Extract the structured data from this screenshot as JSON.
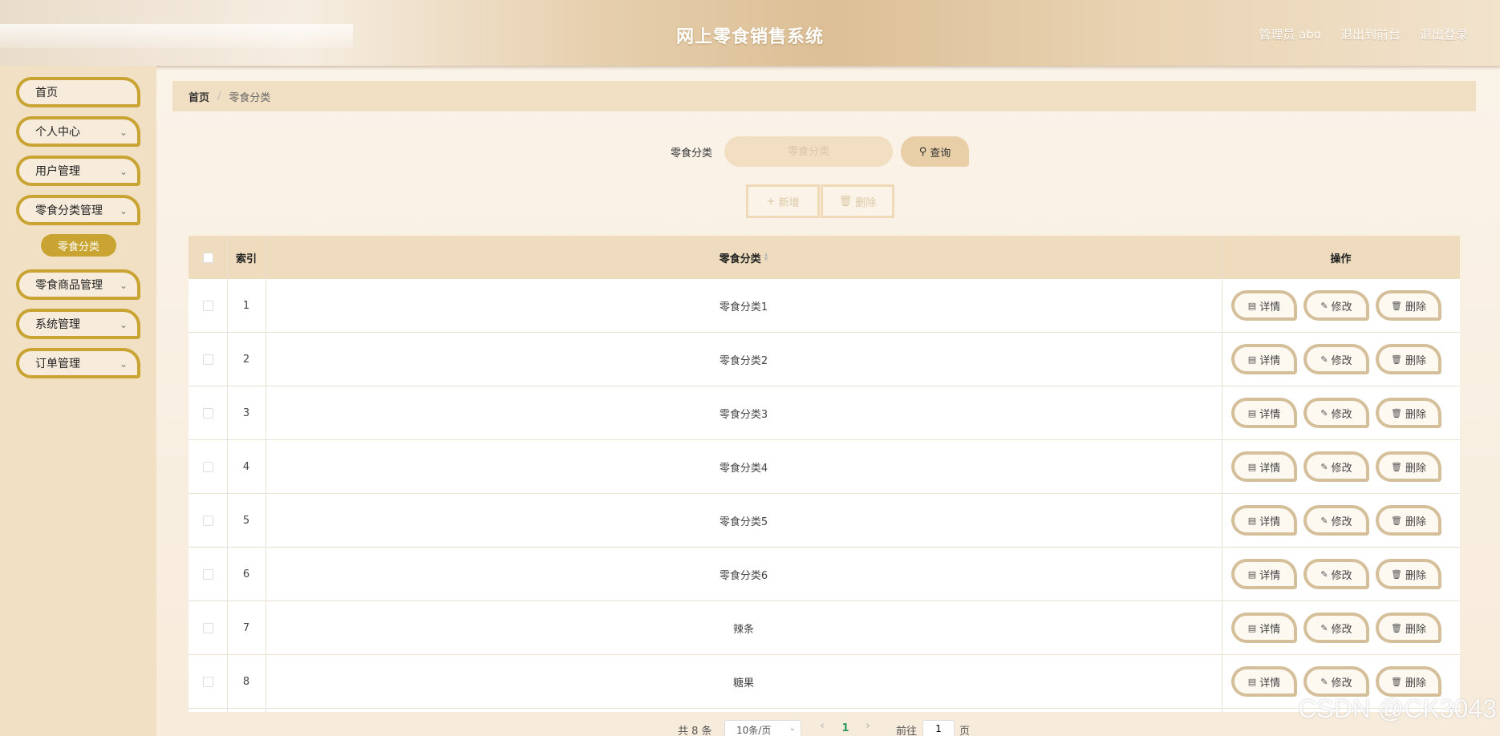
{
  "header": {
    "title": "网上零食销售系统",
    "admin_label": "管理员 abo",
    "front_label": "退出到前台",
    "logout_label": "退出登录"
  },
  "sidebar": {
    "items": [
      {
        "label": "首页",
        "has_children": false
      },
      {
        "label": "个人中心",
        "has_children": true
      },
      {
        "label": "用户管理",
        "has_children": true
      },
      {
        "label": "零食分类管理",
        "has_children": true
      },
      {
        "label": "零食商品管理",
        "has_children": true
      },
      {
        "label": "系统管理",
        "has_children": true
      },
      {
        "label": "订单管理",
        "has_children": true
      }
    ],
    "active_sub": "零食分类"
  },
  "breadcrumb": {
    "home": "首页",
    "sep": "/",
    "current": "零食分类"
  },
  "search": {
    "label": "零食分类",
    "placeholder": "零食分类",
    "button": "查询"
  },
  "actions": {
    "add": "新增",
    "delete": "删除"
  },
  "table": {
    "headers": {
      "index": "索引",
      "category": "零食分类",
      "ops": "操作"
    },
    "ops": {
      "detail": "详情",
      "edit": "修改",
      "delete": "删除"
    },
    "rows": [
      {
        "index": "1",
        "category": "零食分类1"
      },
      {
        "index": "2",
        "category": "零食分类2"
      },
      {
        "index": "3",
        "category": "零食分类3"
      },
      {
        "index": "4",
        "category": "零食分类4"
      },
      {
        "index": "5",
        "category": "零食分类5"
      },
      {
        "index": "6",
        "category": "零食分类6"
      },
      {
        "index": "7",
        "category": "辣条"
      },
      {
        "index": "8",
        "category": "糖果"
      }
    ]
  },
  "pager": {
    "total": "共 8 条",
    "page_size": "10条/页",
    "current_page": "1",
    "goto_label": "前往",
    "goto_value": "1",
    "unit": "页"
  },
  "watermark": "CSDN @CK3043",
  "colors": {
    "accent": "#c9a433",
    "header_bg": "#e6cfad",
    "sidebar_bg": "#f2e0c4",
    "table_head": "#efdcbe"
  }
}
